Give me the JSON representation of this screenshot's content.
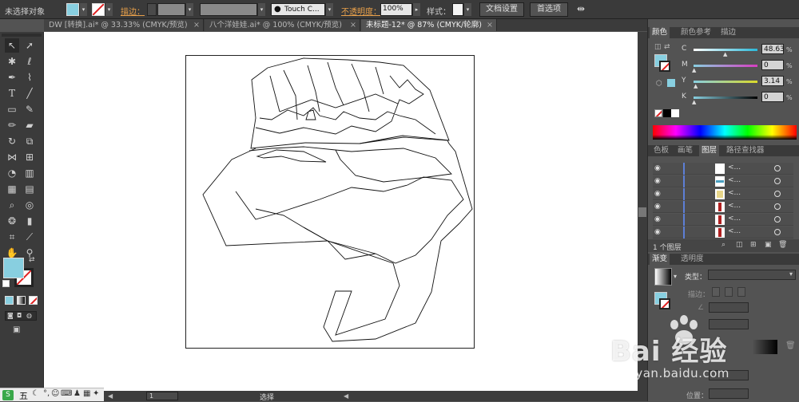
{
  "control_bar": {
    "selection_status": "未选择对象",
    "stroke_label": "描边：",
    "brush_name": "Touch C...",
    "opacity_label": "不透明度：",
    "opacity_value": "100%",
    "style_label": "样式：",
    "doc_setup_button": "文档设置",
    "preferences_button": "首选项"
  },
  "tabs": [
    {
      "label": "DW [转换].ai* @ 33.33% (CMYK/预览)",
      "active": false
    },
    {
      "label": "八个洋娃娃.ai* @ 100% (CMYK/预览)",
      "active": false
    },
    {
      "label": "未标题-12* @ 87% (CMYK/轮廓)",
      "active": true
    }
  ],
  "tab_close_glyph": "×",
  "color_panel": {
    "tabs": [
      "颜色",
      "颜色参考",
      "描边"
    ],
    "channels": [
      {
        "label": "C",
        "value": "48.63",
        "fraction": 0.486,
        "color": "#2bb8d8"
      },
      {
        "label": "M",
        "value": "0",
        "fraction": 0.0,
        "color": "#d63ec1"
      },
      {
        "label": "Y",
        "value": "3.14",
        "fraction": 0.031,
        "color": "#d9d92a"
      },
      {
        "label": "K",
        "value": "0",
        "fraction": 0.0,
        "color": "#7a7a7a"
      }
    ],
    "percent_sign": "%",
    "fill_color": "#88cfe0"
  },
  "layers_panel": {
    "tabs": [
      "色板",
      "画笔",
      "图层",
      "路径查找器"
    ],
    "row_name": "<...",
    "rows": 6,
    "footer_count": "1 个图层"
  },
  "gradient_panel": {
    "tabs": [
      "渐变",
      "透明度"
    ],
    "type_label": "类型：",
    "stroke_label": "描边：",
    "position_label": "位置："
  },
  "status_bar": {
    "zoom_value": "1",
    "tool_status": "选择"
  },
  "watermark": {
    "text": "Bai 经验",
    "url": "jingyan.baidu.com"
  },
  "ime": {
    "label": "五"
  }
}
